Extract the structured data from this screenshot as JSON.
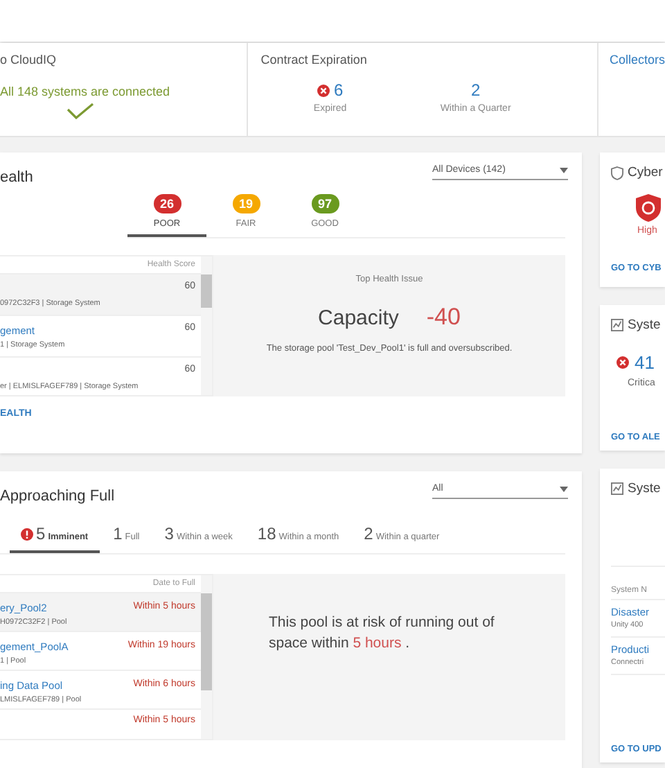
{
  "summary": {
    "connectivity": {
      "title": "o CloudIQ",
      "status": "All 148 systems are connected",
      "connected": true
    },
    "contract": {
      "title": "Contract Expiration",
      "stats": [
        {
          "kind": "expired",
          "value": "6",
          "label": "Expired"
        },
        {
          "kind": "quarter",
          "value": "2",
          "label": "Within a Quarter"
        }
      ]
    },
    "collectors": {
      "title": "Collectors"
    }
  },
  "health": {
    "title": "ealth",
    "filter": "All Devices (142)",
    "tabs": [
      {
        "count": "26",
        "label": "POOR",
        "color": "#d32f2f",
        "selected": true
      },
      {
        "count": "19",
        "label": "FAIR",
        "color": "#f5a800",
        "selected": false
      },
      {
        "count": "97",
        "label": "GOOD",
        "color": "#6a9a1f",
        "selected": false
      }
    ],
    "table": {
      "column": "Health Score",
      "rows": [
        {
          "name": "",
          "detail": "0972C32F3 | Storage System",
          "score": "60",
          "selected": true
        },
        {
          "name": "gement",
          "detail": "1 | Storage System",
          "score": "60",
          "selected": false
        },
        {
          "name": "",
          "detail": "er | ELMISLFAGEF789 | Storage System",
          "score": "60",
          "selected": false
        }
      ]
    },
    "issue": {
      "heading": "Top Health Issue",
      "category": "Capacity",
      "impact": "-40",
      "description": "The storage pool 'Test_Dev_Pool1' is full and oversubscribed."
    },
    "link": "EALTH"
  },
  "pools": {
    "title": "Approaching Full",
    "filter": "All",
    "tabs": [
      {
        "count": "5",
        "label": "Imminent",
        "alert": true,
        "selected": true
      },
      {
        "count": "1",
        "label": "Full",
        "alert": false,
        "selected": false
      },
      {
        "count": "3",
        "label": "Within a week",
        "alert": false,
        "selected": false
      },
      {
        "count": "18",
        "label": "Within a month",
        "alert": false,
        "selected": false
      },
      {
        "count": "2",
        "label": "Within a quarter",
        "alert": false,
        "selected": false
      }
    ],
    "table": {
      "column": "Date to Full",
      "rows": [
        {
          "name": "ery_Pool2",
          "detail": "H0972C32F2 | Pool",
          "due": "Within 5 hours",
          "selected": true
        },
        {
          "name": "gement_PoolA",
          "detail": "1 | Pool",
          "due": "Within 19 hours",
          "selected": false
        },
        {
          "name": "ing Data Pool",
          "detail": "LMISLFAGEF789 | Pool",
          "due": "Within 6 hours",
          "selected": false
        },
        {
          "name": "",
          "detail": "",
          "due": "Within 5 hours",
          "selected": false
        }
      ]
    },
    "message": {
      "before": "This pool is at risk of running out of space within",
      "highlight": "5 hours",
      "after": "."
    }
  },
  "side": {
    "cyber": {
      "title": "Cyber",
      "risk": "High",
      "link": "GO TO CYB"
    },
    "alerts": {
      "title": "Syste",
      "count": "41",
      "label": "Critica",
      "link": "GO TO ALE"
    },
    "updates": {
      "title": "Syste",
      "column": "System N",
      "rows": [
        {
          "name": "Disaster",
          "detail": "Unity 400"
        },
        {
          "name": "Producti",
          "detail": "Connectri"
        }
      ],
      "link": "GO TO UPD"
    }
  }
}
